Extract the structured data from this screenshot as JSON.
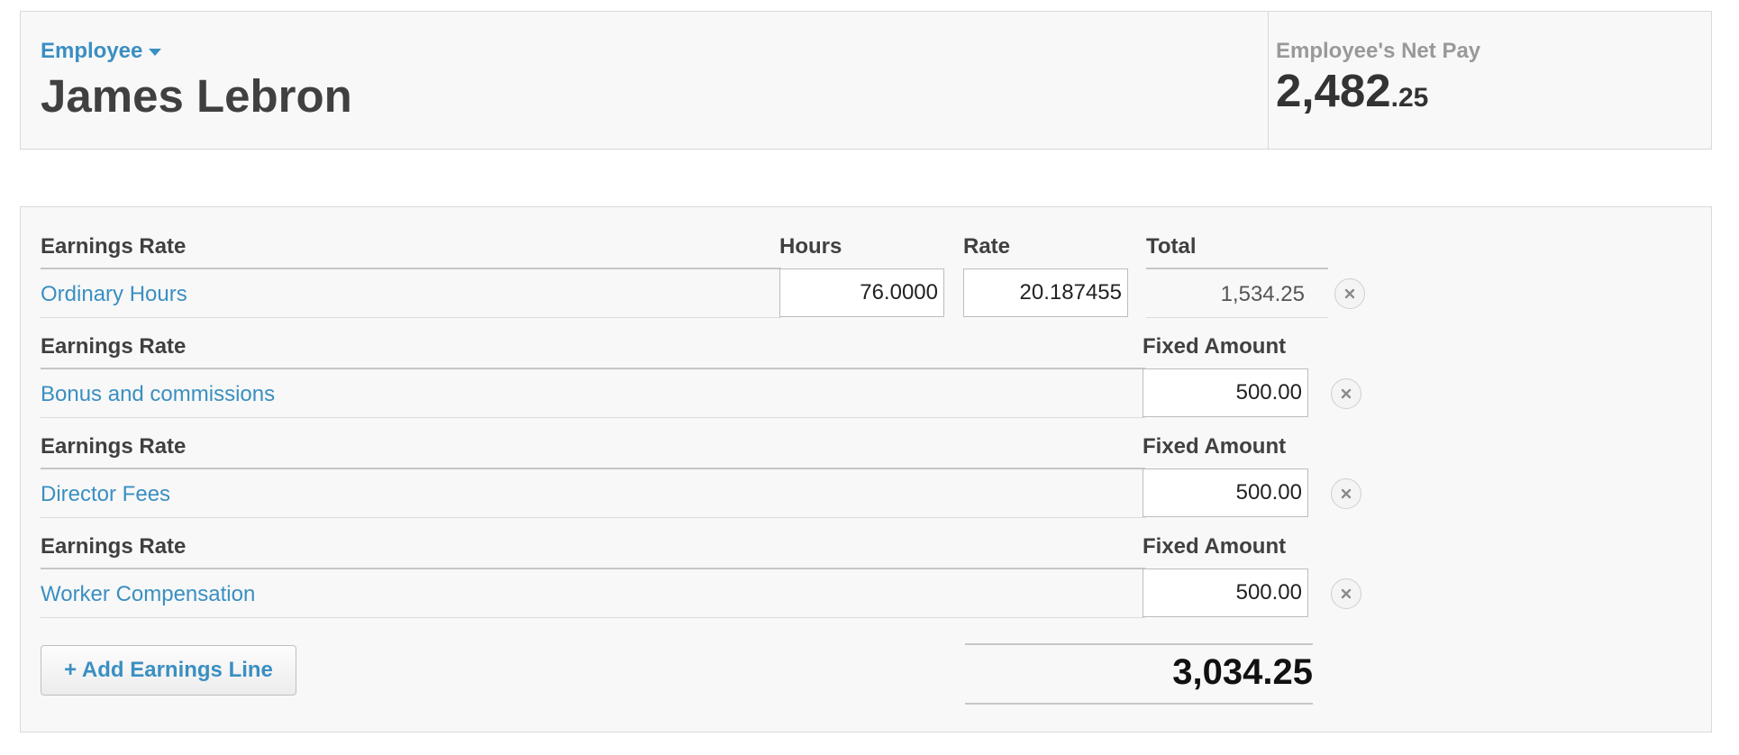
{
  "header": {
    "employee_label": "Employee",
    "employee_name": "James Lebron",
    "net_pay_label": "Employee's Net Pay",
    "net_pay_main": "2,482",
    "net_pay_cents": ".25"
  },
  "earnings": {
    "col_earnings_rate": "Earnings Rate",
    "col_hours": "Hours",
    "col_rate": "Rate",
    "col_total": "Total",
    "col_fixed_amount": "Fixed Amount",
    "ordinary": {
      "label": "Ordinary Hours",
      "hours": "76.0000",
      "rate": "20.187455",
      "total": "1,534.25"
    },
    "lines": [
      {
        "label": "Bonus and commissions",
        "amount": "500.00"
      },
      {
        "label": "Director Fees",
        "amount": "500.00"
      },
      {
        "label": "Worker Compensation",
        "amount": "500.00"
      }
    ],
    "add_button_label": "+ Add Earnings Line",
    "grand_total": "3,034.25"
  },
  "icons": {
    "remove": "close-icon",
    "dropdown": "caret-down-icon"
  },
  "colors": {
    "link": "#3a8fc2",
    "panel_bg": "#f8f8f8",
    "border": "#d9d9d9"
  }
}
